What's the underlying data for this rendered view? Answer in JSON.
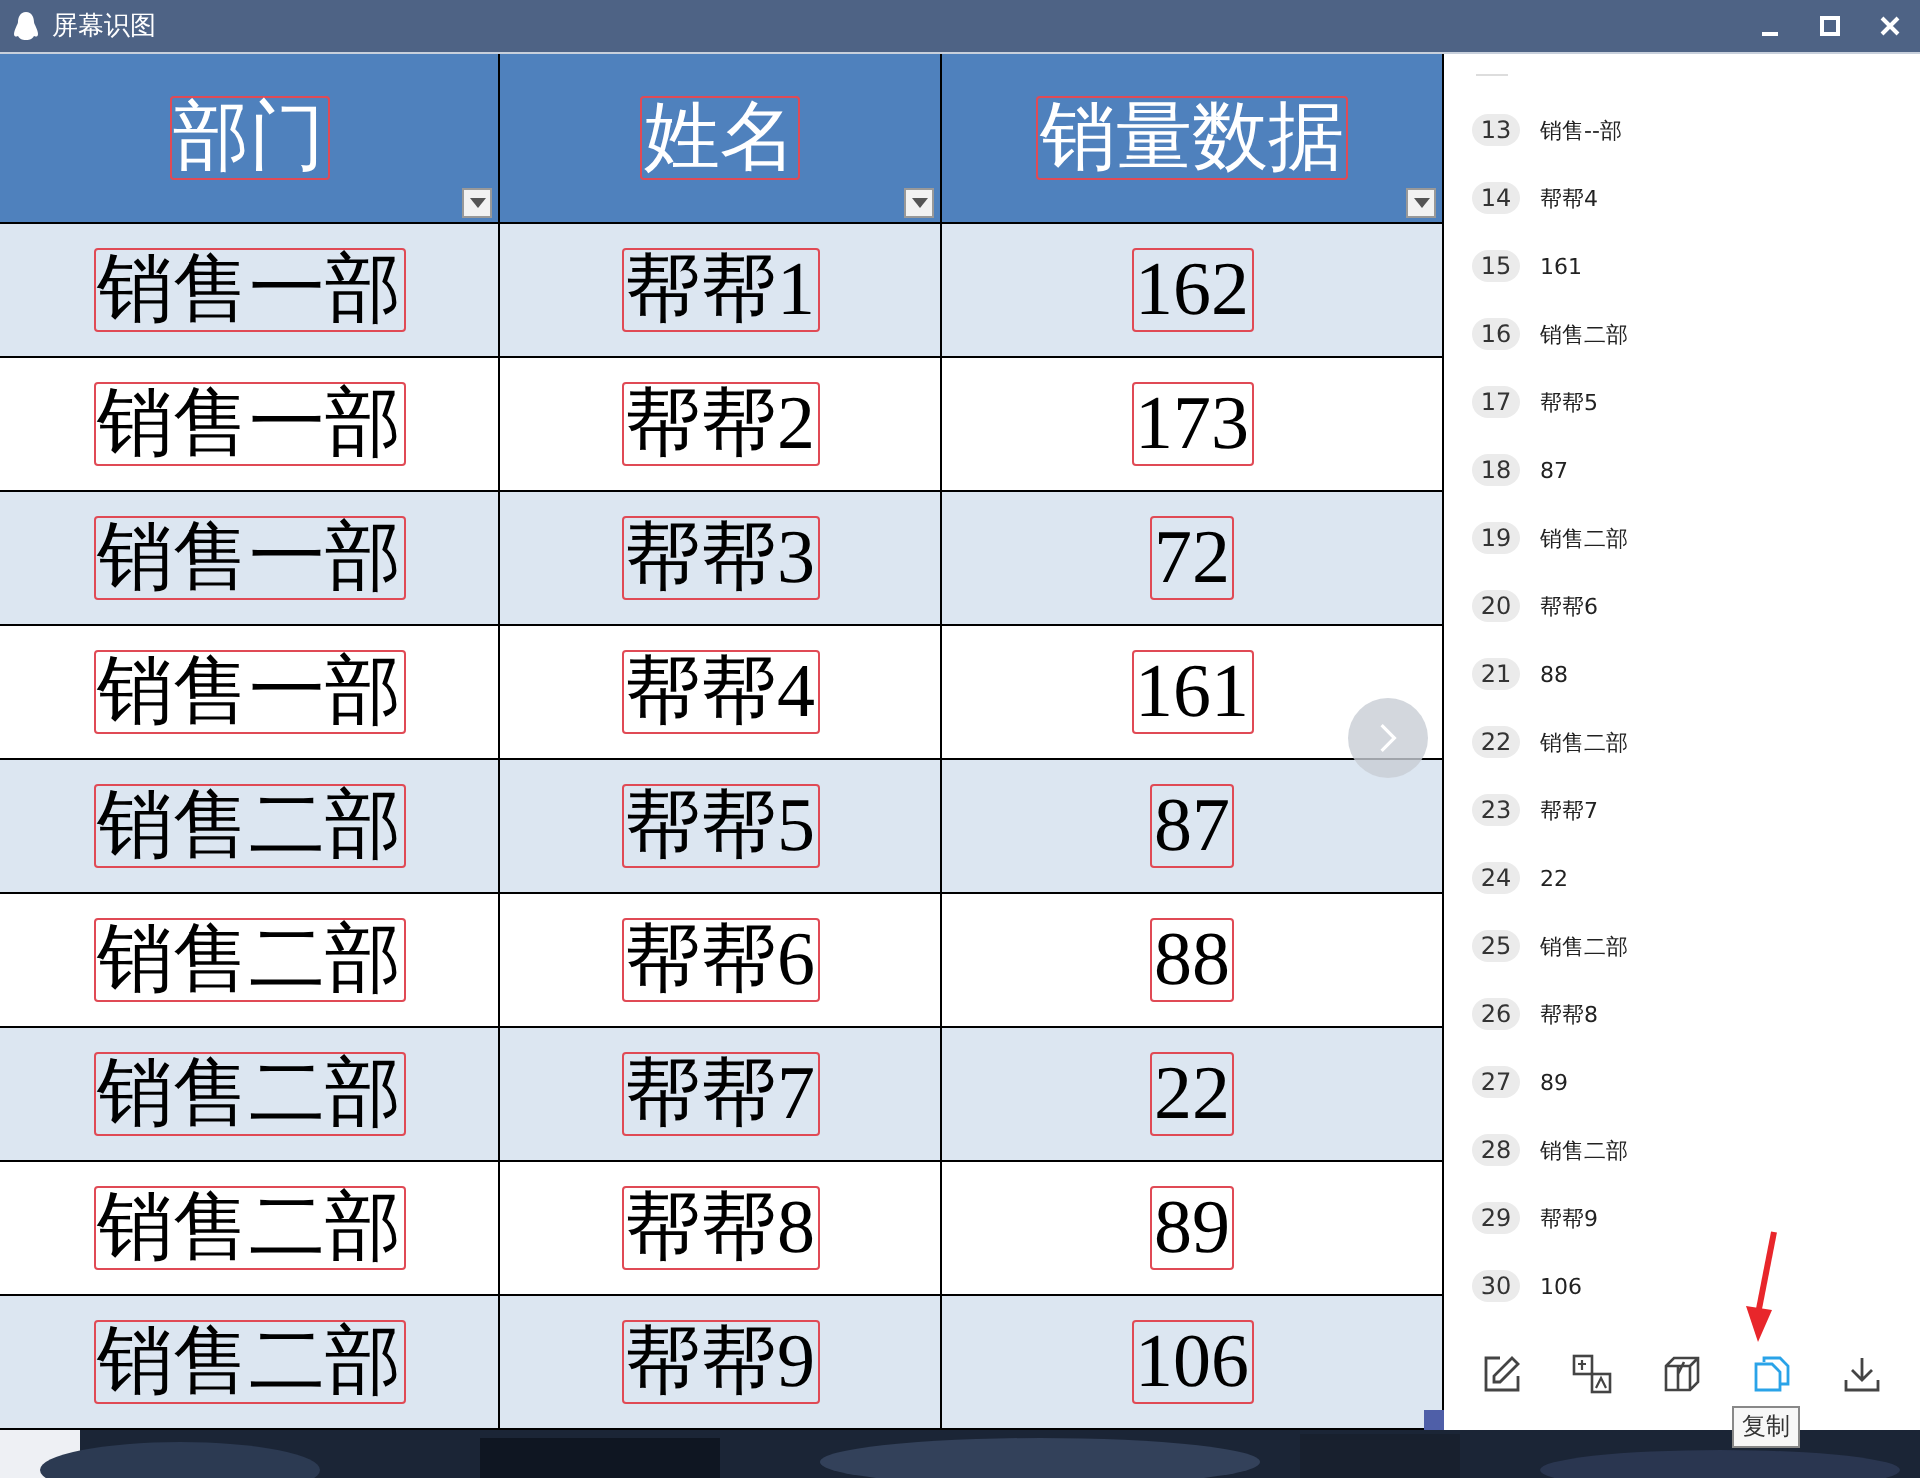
{
  "window": {
    "title": "屏幕识图"
  },
  "table": {
    "columns": [
      {
        "label": "部门"
      },
      {
        "label": "姓名"
      },
      {
        "label": "销量数据"
      }
    ],
    "rows": [
      [
        "销售一部",
        "帮帮1",
        "162"
      ],
      [
        "销售一部",
        "帮帮2",
        "173"
      ],
      [
        "销售一部",
        "帮帮3",
        "72"
      ],
      [
        "销售一部",
        "帮帮4",
        "161"
      ],
      [
        "销售二部",
        "帮帮5",
        "87"
      ],
      [
        "销售二部",
        "帮帮6",
        "88"
      ],
      [
        "销售二部",
        "帮帮7",
        "22"
      ],
      [
        "销售二部",
        "帮帮8",
        "89"
      ],
      [
        "销售二部",
        "帮帮9",
        "106"
      ]
    ]
  },
  "results": [
    {
      "index": "13",
      "text": "销售--部"
    },
    {
      "index": "14",
      "text": "帮帮4"
    },
    {
      "index": "15",
      "text": "161"
    },
    {
      "index": "16",
      "text": "销售二部"
    },
    {
      "index": "17",
      "text": "帮帮5"
    },
    {
      "index": "18",
      "text": "87"
    },
    {
      "index": "19",
      "text": "销售二部"
    },
    {
      "index": "20",
      "text": "帮帮6"
    },
    {
      "index": "21",
      "text": "88"
    },
    {
      "index": "22",
      "text": "销售二部"
    },
    {
      "index": "23",
      "text": "帮帮7"
    },
    {
      "index": "24",
      "text": "22"
    },
    {
      "index": "25",
      "text": "销售二部"
    },
    {
      "index": "26",
      "text": "帮帮8"
    },
    {
      "index": "27",
      "text": "89"
    },
    {
      "index": "28",
      "text": "销售二部"
    },
    {
      "index": "29",
      "text": "帮帮9"
    },
    {
      "index": "30",
      "text": "106"
    }
  ],
  "toolbar": [
    {
      "kind": "edit",
      "hovered": false
    },
    {
      "kind": "translate",
      "hovered": false
    },
    {
      "kind": "box",
      "hovered": false
    },
    {
      "kind": "copy",
      "hovered": true,
      "tooltip": "复制"
    },
    {
      "kind": "download",
      "hovered": false
    }
  ]
}
